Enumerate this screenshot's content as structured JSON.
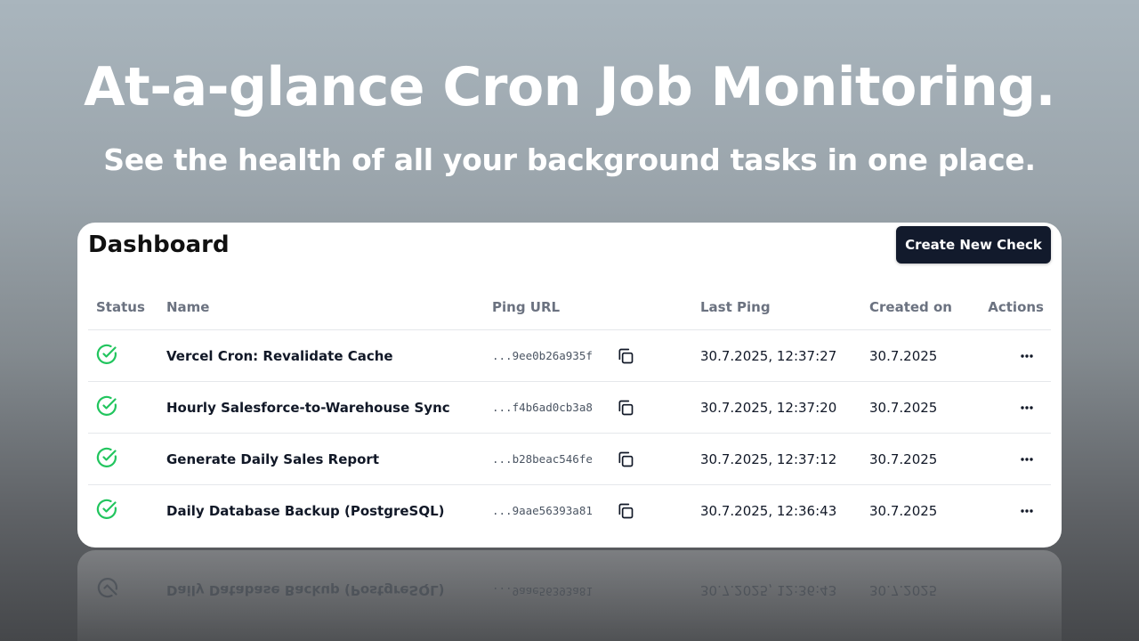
{
  "hero": {
    "title": "At-a-glance Cron Job Monitoring.",
    "subtitle": "See the health of all your background tasks in one place."
  },
  "dashboard": {
    "title": "Dashboard",
    "create_button": "Create New Check",
    "columns": {
      "status": "Status",
      "name": "Name",
      "ping_url": "Ping URL",
      "last_ping": "Last Ping",
      "created_on": "Created on",
      "actions": "Actions"
    },
    "rows": [
      {
        "status": "check-circle-icon",
        "name": "Vercel Cron: Revalidate Cache",
        "ping_url": "...9ee0b26a935f",
        "last_ping": "30.7.2025, 12:37:27",
        "created_on": "30.7.2025"
      },
      {
        "status": "check-circle-icon",
        "name": "Hourly Salesforce-to-Warehouse Sync",
        "ping_url": "...f4b6ad0cb3a8",
        "last_ping": "30.7.2025, 12:37:20",
        "created_on": "30.7.2025"
      },
      {
        "status": "check-circle-icon",
        "name": "Generate Daily Sales Report",
        "ping_url": "...b28beac546fe",
        "last_ping": "30.7.2025, 12:37:12",
        "created_on": "30.7.2025"
      },
      {
        "status": "check-circle-icon",
        "name": "Daily Database Backup (PostgreSQL)",
        "ping_url": "...9aae56393a81",
        "last_ping": "30.7.2025, 12:36:43",
        "created_on": "30.7.2025"
      }
    ]
  },
  "colors": {
    "status_ok": "#22c55e",
    "button_bg": "#121a2c",
    "header_text": "#6b7280"
  },
  "icons": {
    "status": "check-circle-icon",
    "copy": "copy-icon",
    "actions": "more-horizontal-icon"
  }
}
